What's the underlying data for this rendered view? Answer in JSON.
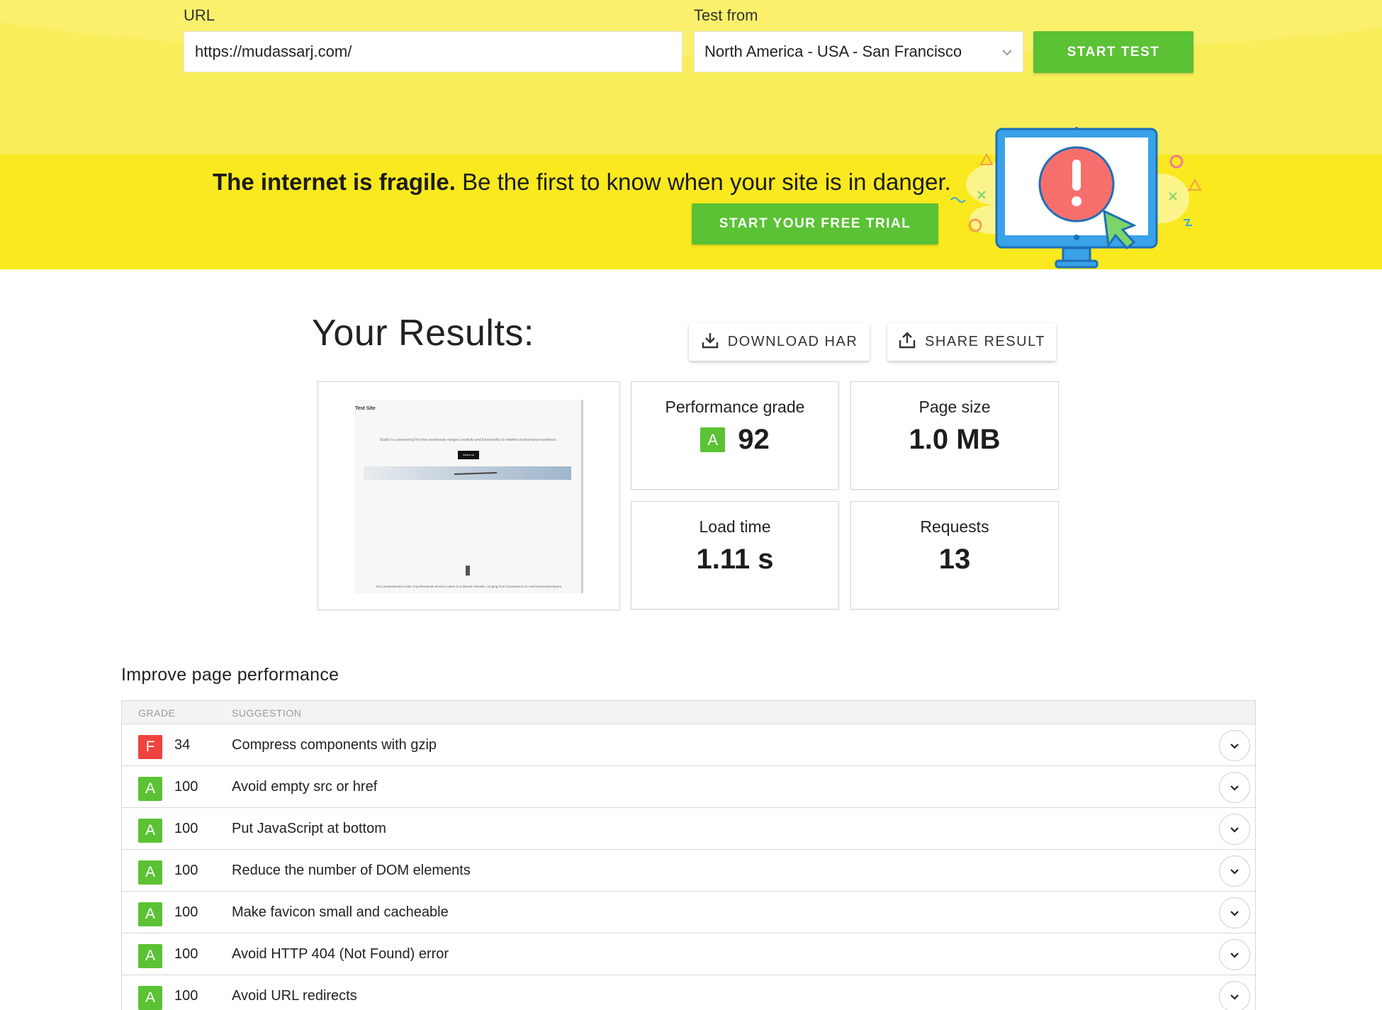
{
  "form": {
    "url_label": "URL",
    "url_value": "https://mudassarj.com/",
    "test_from_label": "Test from",
    "test_from_value": "North America - USA - San Francisco",
    "start_test_label": "START TEST"
  },
  "promo": {
    "headline_bold": "The internet is fragile.",
    "headline_rest": " Be the first to know when your site is in danger.",
    "cta_label": "START YOUR FREE TRIAL"
  },
  "results": {
    "title": "Your Results:",
    "download_har_label": "DOWNLOAD HAR",
    "share_result_label": "SHARE RESULT",
    "screenshot": {
      "site_title": "Test Site",
      "description": "Studio is a pioneering firm that seamlessly merges creativity and functionality to redefine architectural excellence.",
      "button": "About us",
      "footer": "Our comprehensive suite of professional services caters to a diverse clientele, ranging from homeowners to commercial developers."
    },
    "performance_grade": {
      "label": "Performance grade",
      "grade": "A",
      "value": "92"
    },
    "page_size": {
      "label": "Page size",
      "value": "1.0 MB"
    },
    "load_time": {
      "label": "Load time",
      "value": "1.11 s"
    },
    "requests": {
      "label": "Requests",
      "value": "13"
    }
  },
  "improve": {
    "title": "Improve page performance",
    "columns": {
      "grade": "GRADE",
      "suggestion": "SUGGESTION"
    },
    "rows": [
      {
        "grade": "F",
        "score": "34",
        "suggestion": "Compress components with gzip"
      },
      {
        "grade": "A",
        "score": "100",
        "suggestion": "Avoid empty src or href"
      },
      {
        "grade": "A",
        "score": "100",
        "suggestion": "Put JavaScript at bottom"
      },
      {
        "grade": "A",
        "score": "100",
        "suggestion": "Reduce the number of DOM elements"
      },
      {
        "grade": "A",
        "score": "100",
        "suggestion": "Make favicon small and cacheable"
      },
      {
        "grade": "A",
        "score": "100",
        "suggestion": "Avoid HTTP 404 (Not Found) error"
      },
      {
        "grade": "A",
        "score": "100",
        "suggestion": "Avoid URL redirects"
      }
    ]
  },
  "colors": {
    "brand_green": "#5ac234",
    "grade_fail": "#f0433f",
    "promo_yellow": "#f9e91e",
    "form_yellow": "#f8ee5a"
  },
  "icons": {
    "select_chevron": "chevron-down-icon",
    "download": "download-icon",
    "share": "share-icon",
    "row_expand": "chevron-down-icon"
  }
}
